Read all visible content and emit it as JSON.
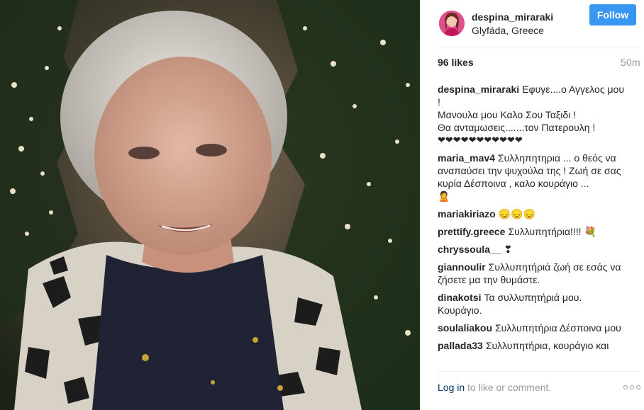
{
  "post": {
    "username": "despina_miraraki",
    "location": "Glyfáda, Greece",
    "follow_label": "Follow",
    "likes": "96 likes",
    "time": "50m"
  },
  "comments": [
    {
      "author": "despina_miraraki",
      "lines": [
        "Εφυγε....ο Αγγελος μου !",
        "Μανουλα μου Καλο Σου Ταξιδι !",
        "Θα ανταμωσεις.......τον Πατερουλη !",
        "❤❤❤❤❤❤❤❤❤❤❤"
      ]
    },
    {
      "author": "maria_mav4",
      "lines": [
        "Συλληπητηρια ... ο θεός να αναπαύσει την ψυχούλα της ! Ζωή σε σας κυρία Δέσποινα , καλο κουράγιο ...",
        "🙎"
      ]
    },
    {
      "author": "mariakiriazo",
      "lines": [
        "😞😞😞"
      ]
    },
    {
      "author": "prettify.greece",
      "lines": [
        "Συλλυπητήρια!!!! 💐"
      ]
    },
    {
      "author": "chryssoula__",
      "lines": [
        "❣"
      ]
    },
    {
      "author": "giannoulir",
      "lines": [
        "Συλλυπητήριά ζωή σε εσάς να ζήσετε μα την θυμάστε."
      ]
    },
    {
      "author": "dinakotsi",
      "lines": [
        "Τα συλλυπητήριά μου. Κουράγιο."
      ]
    },
    {
      "author": "soulaliakou",
      "lines": [
        "Συλλυπητήρια Δέσποινα μου"
      ]
    },
    {
      "author": "pallada33",
      "lines": [
        "Συλλυπητήρια, κουράγιο και"
      ]
    }
  ],
  "footer": {
    "login_link": "Log in",
    "login_rest": " to like or comment."
  },
  "icons": {
    "more": "more-options-icon",
    "avatar": "user-avatar"
  },
  "colors": {
    "follow_button": "#3897f0",
    "link": "#003569",
    "muted": "#999999"
  }
}
